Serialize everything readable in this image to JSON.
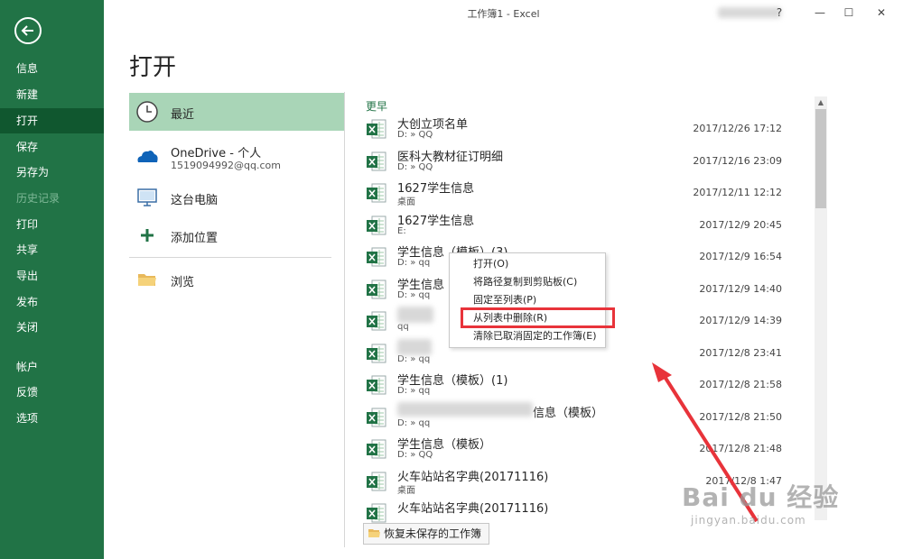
{
  "window": {
    "title": "工作簿1  -  Excel",
    "help": "?",
    "minimize": "—",
    "maximize": "☐",
    "close": "✕"
  },
  "sidebar": {
    "items": [
      {
        "label": "信息",
        "state": "normal"
      },
      {
        "label": "新建",
        "state": "normal"
      },
      {
        "label": "打开",
        "state": "active"
      },
      {
        "label": "保存",
        "state": "normal"
      },
      {
        "label": "另存为",
        "state": "normal"
      },
      {
        "label": "历史记录",
        "state": "disabled"
      },
      {
        "label": "打印",
        "state": "normal"
      },
      {
        "label": "共享",
        "state": "normal"
      },
      {
        "label": "导出",
        "state": "normal"
      },
      {
        "label": "发布",
        "state": "normal"
      },
      {
        "label": "关闭",
        "state": "normal"
      },
      {
        "label": "帐户",
        "state": "normal"
      },
      {
        "label": "反馈",
        "state": "normal"
      },
      {
        "label": "选项",
        "state": "normal"
      }
    ]
  },
  "page": {
    "title": "打开"
  },
  "locations": [
    {
      "label": "最近",
      "icon": "clock-icon"
    },
    {
      "label": "OneDrive - 个人",
      "sub": "1519094992@qq.com",
      "icon": "cloud-icon"
    },
    {
      "label": "这台电脑",
      "icon": "computer-icon"
    },
    {
      "label": "添加位置",
      "icon": "plus-icon"
    },
    {
      "label": "浏览",
      "icon": "folder-icon"
    }
  ],
  "recent": {
    "section": "更早",
    "files": [
      {
        "name": "大创立项名单",
        "path": "D: » QQ",
        "date": "2017/12/26 17:12"
      },
      {
        "name": "医科大教材征订明细",
        "path": "D: » QQ",
        "date": "2017/12/16 23:09"
      },
      {
        "name": "1627学生信息",
        "path": "桌面",
        "date": "2017/12/11 12:12"
      },
      {
        "name": "1627学生信息",
        "path": "E:",
        "date": "2017/12/9 20:45"
      },
      {
        "name": "学生信息（模板）(3)",
        "path": "D: » qq",
        "date": "2017/12/9 16:54"
      },
      {
        "name": "学生信息",
        "path": "D: » qq",
        "date": "2017/12/9 14:40"
      },
      {
        "name": "",
        "path": "qq",
        "date": "2017/12/9 14:39"
      },
      {
        "name": "",
        "path": "D: » qq",
        "date": "2017/12/8 23:41"
      },
      {
        "name": "学生信息（模板）(1)",
        "path": "D: » qq",
        "date": "2017/12/8 21:58"
      },
      {
        "name": "信息（模板）",
        "path": "D: » qq",
        "date": "2017/12/8 21:50"
      },
      {
        "name": "学生信息（模板）",
        "path": "D: » QQ",
        "date": "2017/12/8 21:48"
      },
      {
        "name": "火车站站名字典(20171116)",
        "path": "桌面",
        "date": "2017/12/8 1:47"
      },
      {
        "name": "火车站站名字典(20171116)",
        "path": "",
        "date": ""
      }
    ]
  },
  "recover_button": "恢复未保存的工作簿",
  "context_menu": {
    "items": [
      "打开(O)",
      "将路径复制到剪贴板(C)",
      "固定至列表(P)",
      "从列表中删除(R)",
      "清除已取消固定的工作簿(E)"
    ]
  },
  "watermark": {
    "logo": "Bai du 经验",
    "url": "jingyan.baidu.com"
  },
  "colors": {
    "brand": "#217346",
    "active_nav": "#10572f",
    "active_location": "#a9d5b7",
    "annotation": "#e8333a"
  }
}
